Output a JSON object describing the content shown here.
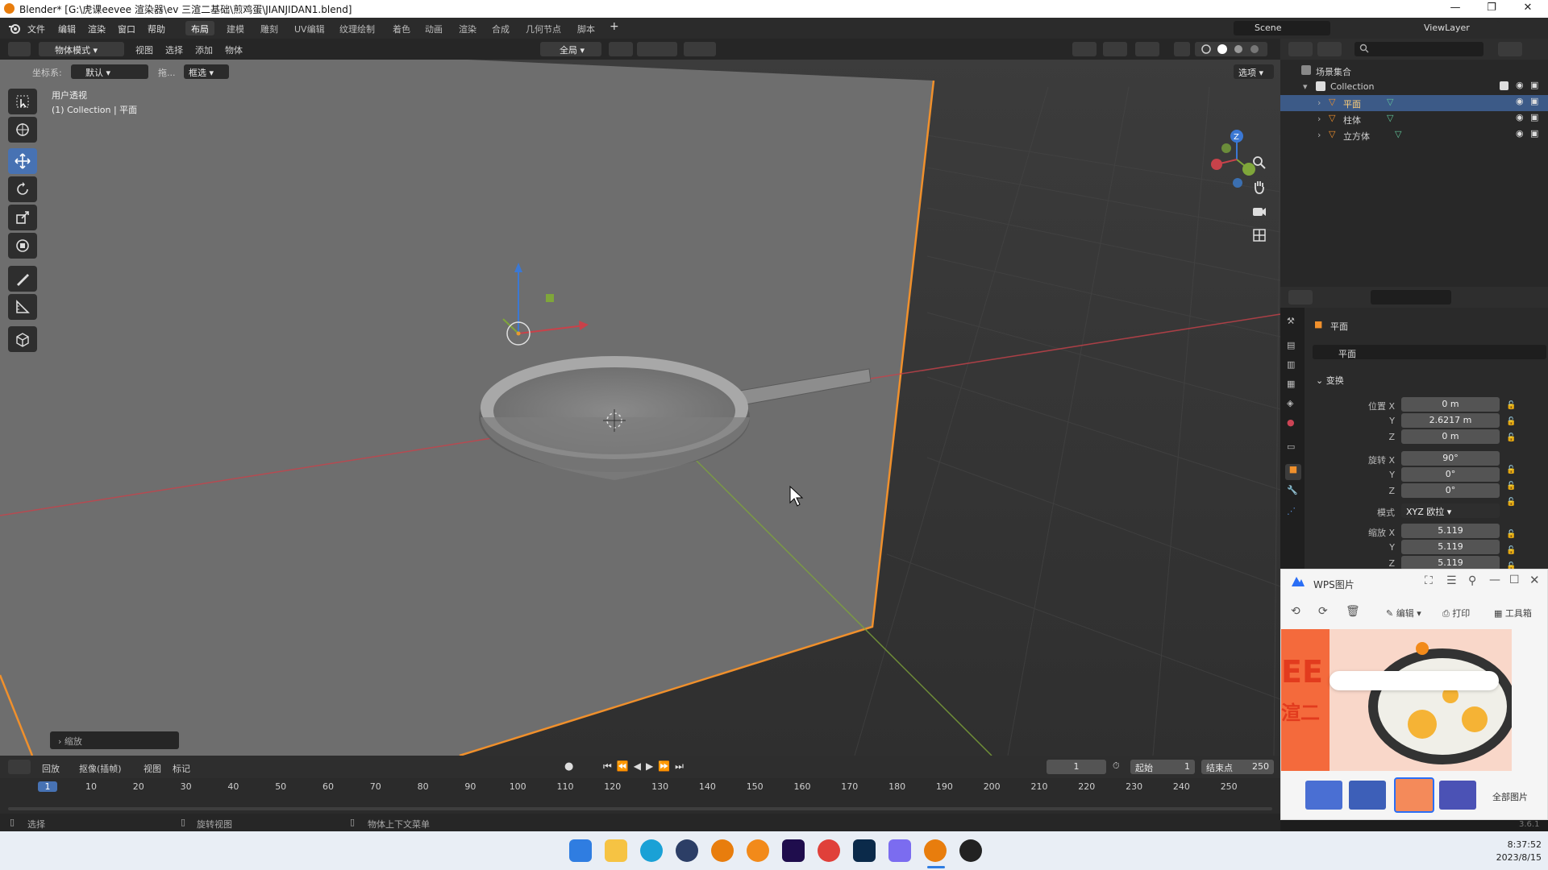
{
  "window": {
    "title": "Blender* [G:\\虎课eevee 渲染器\\ev 三渲二基础\\煎鸡蛋\\JIANJIDAN1.blend]",
    "minimize": "—",
    "maximize": "❐",
    "close": "✕"
  },
  "menu": {
    "items": [
      "文件",
      "编辑",
      "渲染",
      "窗口",
      "帮助"
    ],
    "workspaces": [
      "布局",
      "建模",
      "雕刻",
      "UV编辑",
      "纹理绘制",
      "着色",
      "动画",
      "渲染",
      "合成",
      "几何节点",
      "脚本"
    ],
    "add_workspace": "+",
    "scene": "Scene",
    "view_layer": "ViewLayer"
  },
  "viewport_header": {
    "mode": "物体模式",
    "menus": [
      "视图",
      "选择",
      "添加",
      "物体"
    ],
    "transform_orientation": "全局",
    "coordinate_label": "坐标系:",
    "coordinate_value": "默认",
    "drag_label": "拖...",
    "select_box": "框选",
    "options": "选项"
  },
  "viewport": {
    "view_name": "用户透视",
    "collection_info": "(1) Collection | 平面",
    "operator_panel": "缩放"
  },
  "outliner": {
    "root": "场景集合",
    "collection": "Collection",
    "objects": [
      {
        "name": "平面",
        "selected": true
      },
      {
        "name": "柱体",
        "selected": false
      },
      {
        "name": "立方体",
        "selected": false
      }
    ]
  },
  "properties": {
    "object_name": "平面",
    "object_name_field": "平面",
    "section": "变换",
    "location": {
      "label_x": "位置 X",
      "x": "0 m",
      "y": "2.6217 m",
      "z": "0 m"
    },
    "rotation": {
      "label_x": "旋转 X",
      "x": "90°",
      "y": "0°",
      "z": "0°"
    },
    "mode_label": "模式",
    "mode_value": "XYZ 欧拉",
    "scale": {
      "label_x": "缩放 X",
      "x": "5.119",
      "y": "5.119",
      "z": "5.119"
    },
    "axis_y": "Y",
    "axis_z": "Z"
  },
  "wps": {
    "title": "WPS图片",
    "edit": "编辑",
    "print": "打印",
    "toolbox": "工具箱",
    "all_images": "全部图片",
    "version": "3.6.1"
  },
  "timeline": {
    "menus": [
      "回放",
      "抠像(插帧)",
      "视图",
      "标记"
    ],
    "current_frame": "1",
    "start_label": "起始",
    "start_value": "1",
    "end_label": "结束点",
    "end_value": "250",
    "ticks": [
      "1",
      "10",
      "20",
      "30",
      "40",
      "50",
      "60",
      "70",
      "80",
      "90",
      "100",
      "110",
      "120",
      "130",
      "140",
      "150",
      "160",
      "170",
      "180",
      "190",
      "200",
      "210",
      "220",
      "230",
      "240",
      "250"
    ]
  },
  "statusbar": {
    "select": "选择",
    "rotate_view": "旋转视图",
    "context_menu": "物体上下文菜单"
  },
  "taskbar": {
    "time": "8:37:52",
    "date": "2023/8/15"
  },
  "colors": {
    "accent": "#4772b3",
    "selection_outline": "#f0902c",
    "x_axis": "#c8424a",
    "y_axis": "#7fa63a",
    "z_axis": "#3b78d4"
  }
}
